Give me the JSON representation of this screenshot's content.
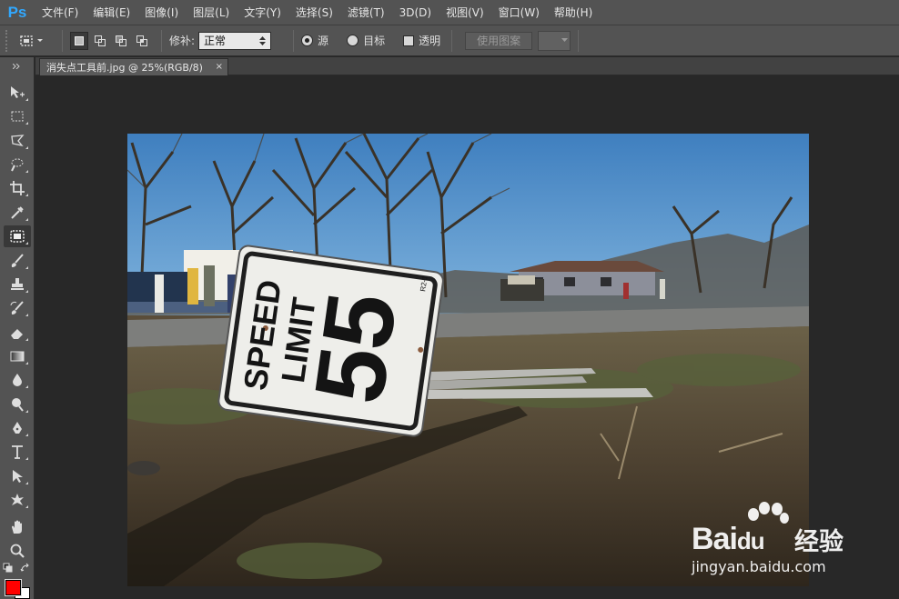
{
  "app": {
    "logo": "Ps"
  },
  "menu": [
    "文件(F)",
    "编辑(E)",
    "图像(I)",
    "图层(L)",
    "文字(Y)",
    "选择(S)",
    "滤镜(T)",
    "3D(D)",
    "视图(V)",
    "窗口(W)",
    "帮助(H)"
  ],
  "options": {
    "patch_label": "修补:",
    "patch_mode": "正常",
    "source_label": "源",
    "target_label": "目标",
    "transparent_label": "透明",
    "use_pattern_label": "使用图案"
  },
  "document": {
    "tab_title": "消失点工具前.jpg @ 25%(RGB/8)",
    "close_glyph": "×"
  },
  "photo_content": {
    "sign_line1": "SPEED",
    "sign_line2": "LIMIT",
    "sign_number": "55",
    "sign_code": "R2-1"
  },
  "watermark": {
    "brand": "Bai",
    "brand2": "du",
    "cn": "经验",
    "url": "jingyan.baidu.com"
  },
  "colors": {
    "foreground": "#ff0000",
    "background": "#ffffff",
    "accent": "#31a8ff"
  }
}
